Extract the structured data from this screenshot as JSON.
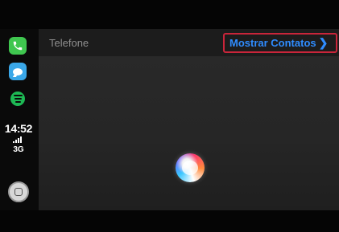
{
  "sidebar": {
    "apps": [
      {
        "name": "phone",
        "icon": "phone-icon",
        "color": "#3fc64f"
      },
      {
        "name": "messages",
        "icon": "message-bubble-icon",
        "color": "#3aa7e8"
      },
      {
        "name": "spotify",
        "icon": "spotify-icon",
        "color": "#1db954"
      }
    ],
    "time": "14:52",
    "network": "3G",
    "signal_icon": "signal-bars-icon",
    "home_icon": "home-button-icon"
  },
  "header": {
    "title": "Telefone",
    "action_label": "Mostrar Contatos",
    "action_icon": "chevron-right-icon",
    "action_color": "#2f8cff",
    "highlight_color": "#c9253a"
  },
  "main": {
    "siri_icon": "siri-orb-icon"
  }
}
